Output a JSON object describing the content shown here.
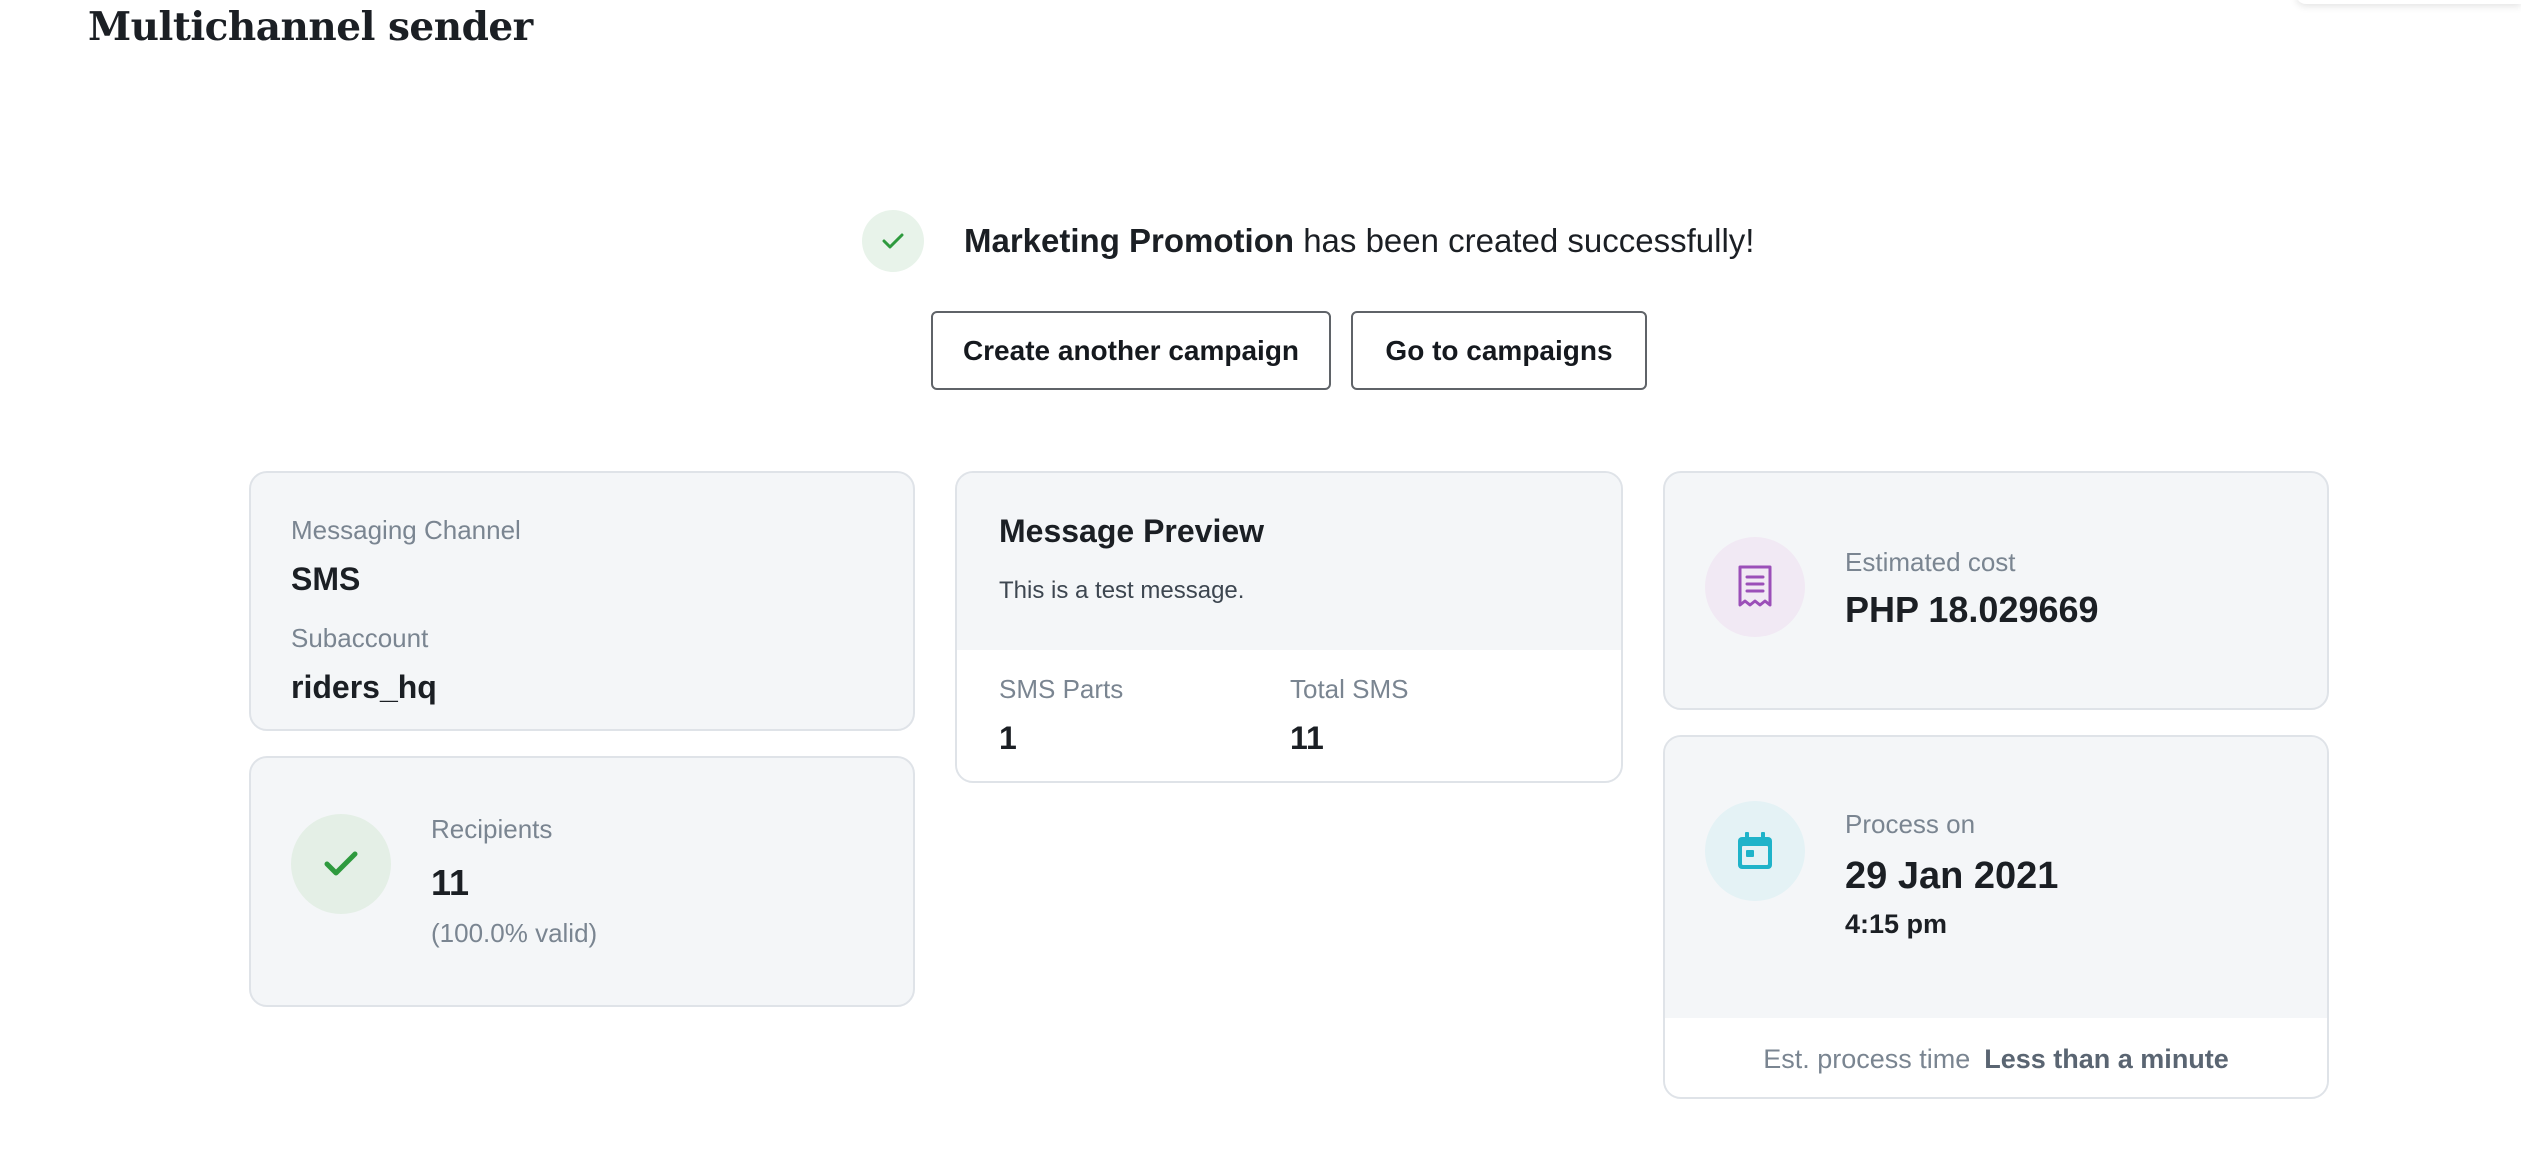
{
  "app": {
    "title": "Multichannel sender"
  },
  "success": {
    "campaign_name": "Marketing Promotion",
    "message_suffix": " has been created successfully!"
  },
  "actions": {
    "create_another_label": "Create another campaign",
    "go_to_campaigns_label": "Go to campaigns"
  },
  "channel_card": {
    "channel_label": "Messaging Channel",
    "channel_value": "SMS",
    "subaccount_label": "Subaccount",
    "subaccount_value": "riders_hq"
  },
  "recipients_card": {
    "label": "Recipients",
    "count": "11",
    "valid_text": "(100.0% valid)"
  },
  "preview_card": {
    "title": "Message Preview",
    "message": "This is a test message.",
    "sms_parts_label": "SMS Parts",
    "sms_parts_value": "1",
    "total_sms_label": "Total SMS",
    "total_sms_value": "11"
  },
  "cost_card": {
    "label": "Estimated cost",
    "value": "PHP 18.029669"
  },
  "process_card": {
    "label": "Process on",
    "date": "29 Jan 2021",
    "time": "4:15 pm",
    "est_label": "Est. process time",
    "est_value": "Less than a minute"
  },
  "icons": {
    "success": "check-icon",
    "recipients": "check-icon",
    "cost": "receipt-icon",
    "process": "calendar-icon"
  },
  "colors": {
    "success_green": "#2e9a3e",
    "receipt_purple": "#9b4fb8",
    "calendar_teal": "#1fb3c9"
  }
}
